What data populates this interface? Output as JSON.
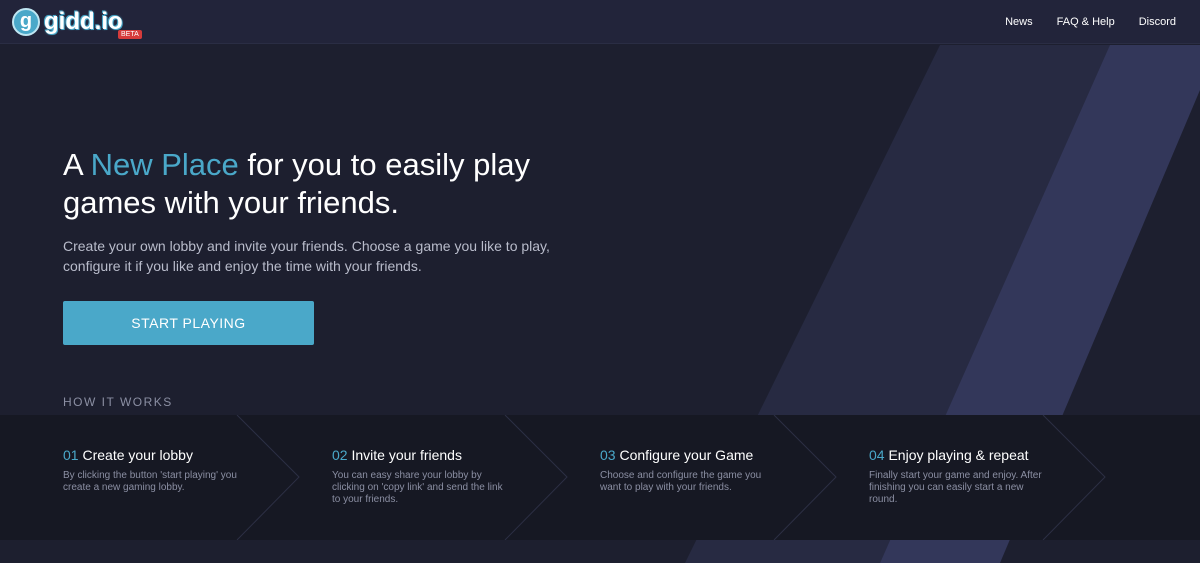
{
  "header": {
    "logo_text": "gidd.io",
    "badge": "BETA",
    "nav": [
      "News",
      "FAQ & Help",
      "Discord"
    ]
  },
  "hero": {
    "title_pre": "A ",
    "title_accent": "New Place",
    "title_post": " for you to easily play games with your friends.",
    "subtitle": "Create your own lobby and invite your friends. Choose a game you like to play, configure it if you like and enjoy the time with your friends.",
    "cta": "START PLAYING"
  },
  "how": {
    "label": "HOW IT WORKS",
    "steps": [
      {
        "num": "01",
        "title": "Create your lobby",
        "text": "By clicking the button 'start playing' you create a new gaming lobby."
      },
      {
        "num": "02",
        "title": "Invite your friends",
        "text": "You can easy share your lobby by clicking on 'copy link' and send the link to your friends."
      },
      {
        "num": "03",
        "title": "Configure your Game",
        "text": "Choose and configure the game you want to play with your friends."
      },
      {
        "num": "04",
        "title": "Enjoy playing & repeat",
        "text": "Finally start your game and enjoy. After finishing you can easily start a new round."
      }
    ]
  },
  "colors": {
    "accent": "#4aa8c9",
    "badge": "#d63b3b"
  }
}
